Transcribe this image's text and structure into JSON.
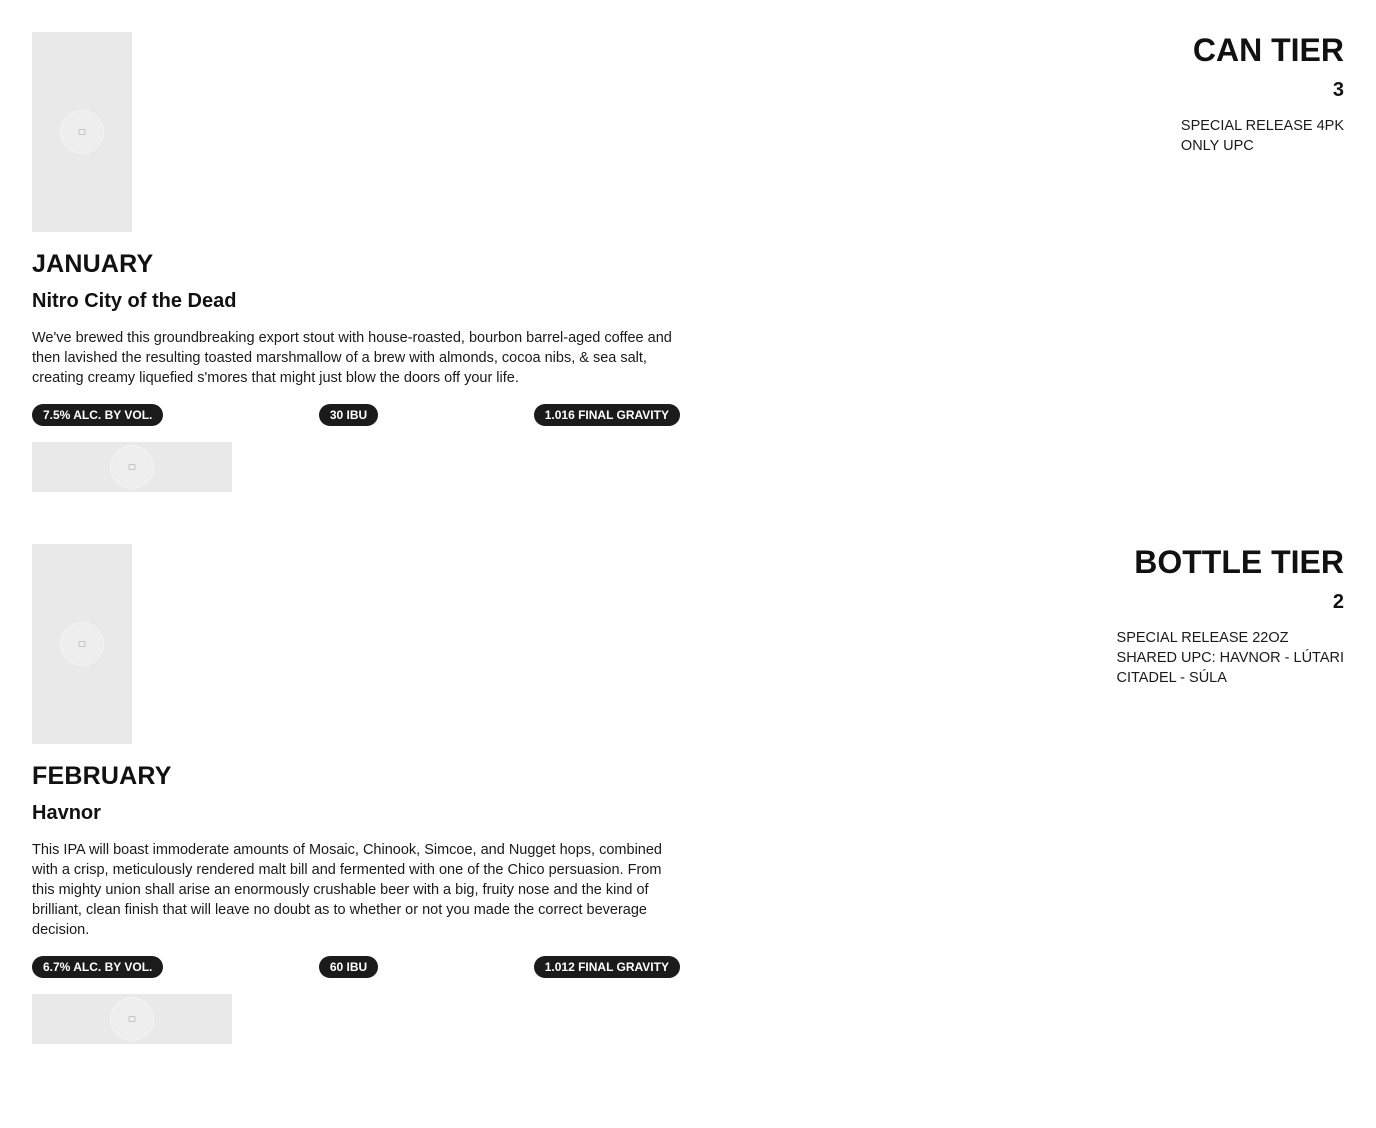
{
  "releases": [
    {
      "month": "JANUARY",
      "name": "Nitro City of the Dead",
      "description": "We've brewed this groundbreaking export stout with house-roasted, bourbon barrel-aged coffee and then lavished the resulting toasted marshmallow of a brew with almonds, cocoa nibs, & sea salt, creating creamy liquefied s'mores that might just blow the doors off your life.",
      "abv": "7.5% ALC. BY VOL.",
      "ibu": "30 IBU",
      "gravity": "1.016 FINAL GRAVITY",
      "tier_title": "CAN TIER",
      "tier_number": "3",
      "tier_note_lines": [
        "SPECIAL RELEASE 4PK",
        "ONLY UPC"
      ]
    },
    {
      "month": "FEBRUARY",
      "name": "Havnor",
      "description": "This IPA will boast immoderate amounts of Mosaic, Chinook, Simcoe, and Nugget hops, combined with a crisp, meticulously rendered malt bill and fermented with one of the Chico persuasion. From this mighty union shall arise an enormously crushable beer with a big, fruity nose and the kind of brilliant, clean finish that will leave no doubt as to whether or not you made the correct beverage decision.",
      "abv": "6.7% ALC. BY VOL.",
      "ibu": "60 IBU",
      "gravity": "1.012 FINAL GRAVITY",
      "tier_title": "BOTTLE TIER",
      "tier_number": "2",
      "tier_note_lines": [
        "SPECIAL RELEASE 22OZ",
        "SHARED UPC: HAVNOR - LÚTARI",
        "CITADEL - SÚLA"
      ]
    }
  ],
  "colors": {
    "pill_background": "#1b1b1b",
    "placeholder": "#e9e9e9",
    "text": "#111111"
  },
  "icons": {
    "image_placeholder": "image-placeholder-icon"
  }
}
